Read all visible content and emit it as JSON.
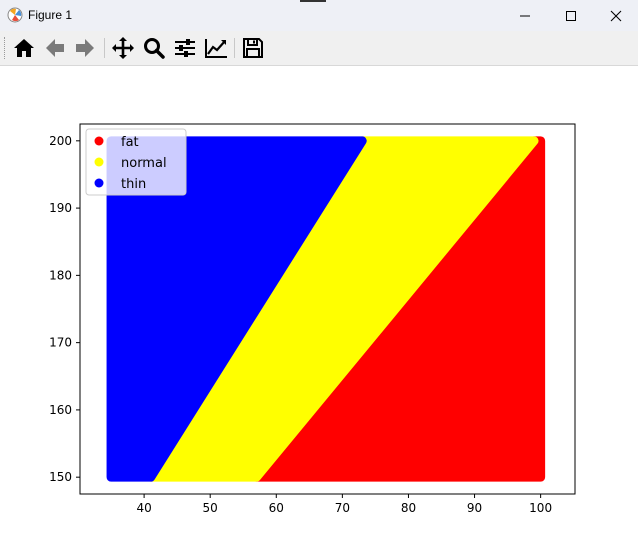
{
  "window": {
    "title": "Figure 1"
  },
  "toolbar": {
    "buttons": [
      {
        "name": "home",
        "icon": "home-icon"
      },
      {
        "name": "back",
        "icon": "arrow-left-icon"
      },
      {
        "name": "forward",
        "icon": "arrow-right-icon"
      },
      {
        "name": "pan",
        "icon": "move-icon"
      },
      {
        "name": "zoom",
        "icon": "magnifier-icon"
      },
      {
        "name": "configure-subplots",
        "icon": "sliders-icon"
      },
      {
        "name": "edit-axis",
        "icon": "line-chart-icon"
      },
      {
        "name": "save",
        "icon": "floppy-disk-icon"
      }
    ]
  },
  "chart_data": {
    "type": "scatter",
    "title": "",
    "xlabel": "",
    "ylabel": "",
    "xlim": [
      30.3,
      105.2
    ],
    "ylim": [
      147.5,
      202.5
    ],
    "x_ticks": [
      40,
      50,
      60,
      70,
      80,
      90,
      100
    ],
    "y_ticks": [
      150,
      160,
      170,
      180,
      190,
      200
    ],
    "grid": false,
    "legend_position": "upper left",
    "x_range": [
      35,
      100
    ],
    "y_range": [
      150,
      200
    ],
    "boundaries": [
      {
        "between": [
          "thin",
          "normal"
        ],
        "from": [
          41,
          150
        ],
        "to": [
          73,
          200
        ]
      },
      {
        "between": [
          "normal",
          "fat"
        ],
        "from": [
          57,
          150
        ],
        "to": [
          99,
          200
        ]
      }
    ],
    "series": [
      {
        "name": "fat",
        "color": "#ff0000"
      },
      {
        "name": "normal",
        "color": "#ffff00"
      },
      {
        "name": "thin",
        "color": "#0000ff"
      }
    ]
  }
}
